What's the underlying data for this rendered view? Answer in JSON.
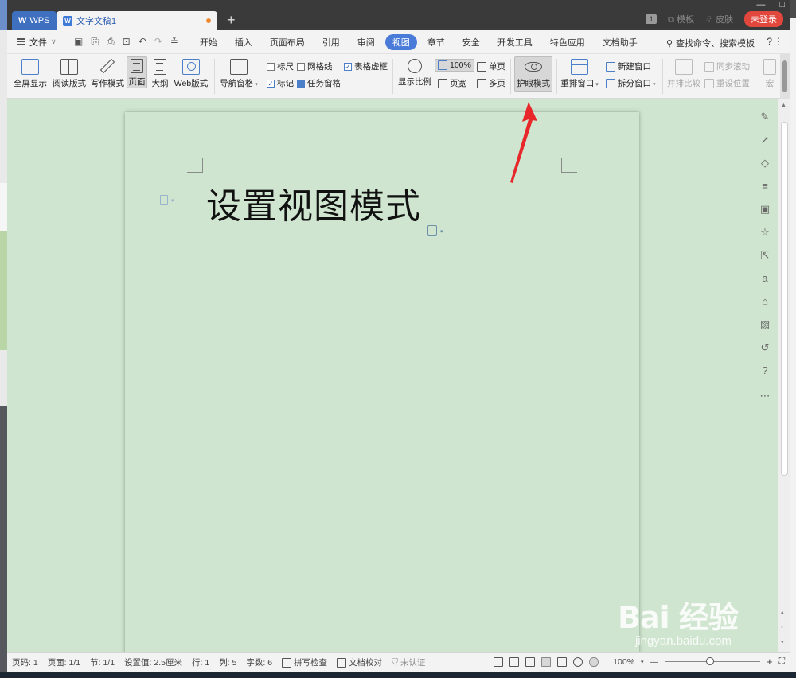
{
  "titlebar": {
    "app_tab": "WPS",
    "doc_tab": "文字文稿1",
    "new_tab_glyph": "+",
    "badge": "1",
    "template_label": "模板",
    "skin_label": "皮肤",
    "login_label": "未登录"
  },
  "menu": {
    "file_label": "文件",
    "tabs": [
      "开始",
      "插入",
      "页面布局",
      "引用",
      "审阅",
      "视图",
      "章节",
      "安全",
      "开发工具",
      "特色应用",
      "文档助手"
    ],
    "active_tab": "视图",
    "search_label": "查找命令、搜索模板",
    "help_glyph": "?",
    "more_glyph": "⋮"
  },
  "ribbon": {
    "fullscreen": "全屏显示",
    "reading": "阅读版式",
    "writing": "写作模式",
    "page": "页面",
    "outline": "大纲",
    "web": "Web版式",
    "nav_pane": "导航窗格",
    "ruler": "标尺",
    "gridlines": "网格线",
    "table_grid": "表格虚框",
    "marks": "标记",
    "task_pane": "任务窗格",
    "zoom_ratio": "显示比例",
    "zoom_100": "100%",
    "page_width": "页宽",
    "single_page": "单页",
    "multi_page": "多页",
    "eye_mode": "护眼模式",
    "rearrange": "重排窗口",
    "new_window": "新建窗口",
    "split_window": "拆分窗口",
    "side_by_side": "并排比较",
    "sync_scroll": "同步滚动",
    "reset_pos": "重设位置",
    "macro": "宏"
  },
  "checkboxes": {
    "ruler": false,
    "gridlines": false,
    "table_grid": true,
    "marks": true,
    "task_pane": true
  },
  "document": {
    "title": "设置视图模式"
  },
  "statusbar": {
    "page_no": "页码: 1",
    "pages": "页面: 1/1",
    "section": "节: 1/1",
    "setting": "设置值: 2.5厘米",
    "row": "行: 1",
    "col": "列: 5",
    "words": "字数: 6",
    "spellcheck": "拼写检查",
    "doc_check": "文档校对",
    "auth": "未认证",
    "zoom": "100%",
    "minus": "—",
    "plus": "+"
  },
  "watermark": {
    "logo": "Bai 经验",
    "url": "jingyan.baidu.com"
  },
  "sidepanel_icons": [
    "pen-icon",
    "cursor-icon",
    "shapes-icon",
    "settings-icon",
    "image-frame-icon",
    "star-icon",
    "share-icon",
    "translate-icon",
    "archive-icon",
    "picture-icon",
    "history-icon",
    "help-icon",
    "more-icon"
  ],
  "colors": {
    "accent": "#4a7bd8",
    "eye_background": "#cfe5cf",
    "login": "#e2473d",
    "arrow": "#e8272a"
  }
}
